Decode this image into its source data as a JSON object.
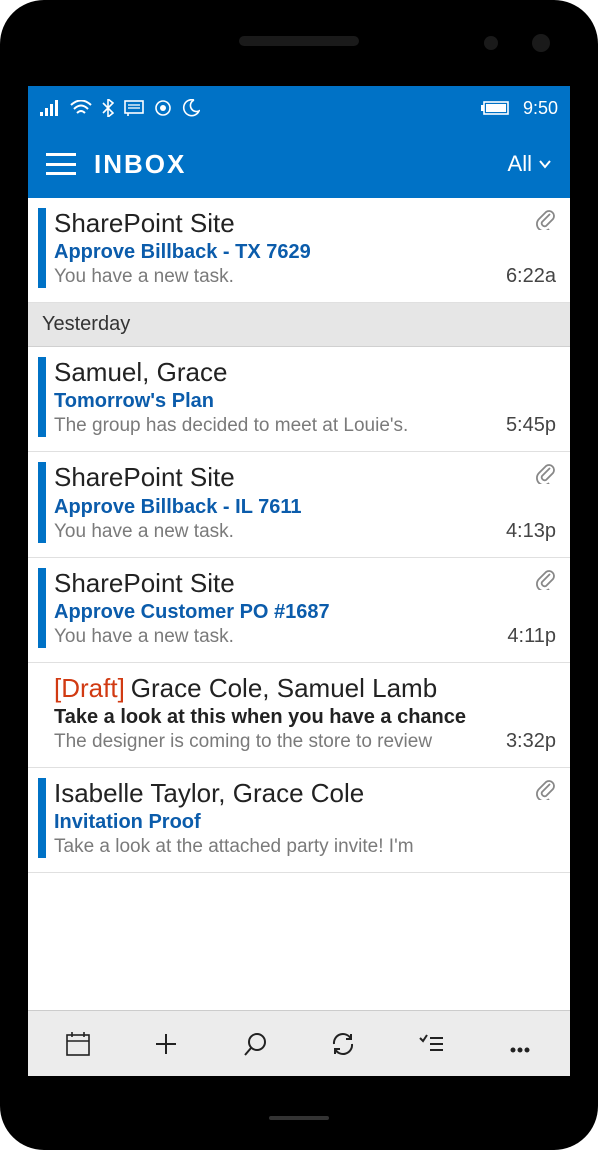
{
  "status": {
    "time": "9:50"
  },
  "appbar": {
    "title": "INBOX",
    "filter_label": "All"
  },
  "sections": [
    {
      "header": null,
      "items": [
        {
          "sender": "SharePoint Site",
          "draft": false,
          "subject": "Approve Billback - TX 7629",
          "subject_colored": true,
          "preview": "You have a new task.",
          "time": "6:22a",
          "attachment": true,
          "unread": true
        }
      ]
    },
    {
      "header": "Yesterday",
      "items": [
        {
          "sender": "Samuel, Grace",
          "draft": false,
          "subject": "Tomorrow's Plan",
          "subject_colored": true,
          "preview": "The group has decided to meet at Louie's.",
          "time": "5:45p",
          "attachment": false,
          "unread": true
        },
        {
          "sender": "SharePoint Site",
          "draft": false,
          "subject": "Approve Billback - IL 7611",
          "subject_colored": true,
          "preview": "You have a new task.",
          "time": "4:13p",
          "attachment": true,
          "unread": true
        },
        {
          "sender": "SharePoint Site",
          "draft": false,
          "subject": "Approve Customer PO #1687",
          "subject_colored": true,
          "preview": "You have a new task.",
          "time": "4:11p",
          "attachment": true,
          "unread": true
        },
        {
          "sender": "Grace Cole, Samuel Lamb",
          "draft": true,
          "draft_label": "[Draft]",
          "subject": "Take a look at this when you have a chance",
          "subject_colored": false,
          "preview": "The designer is coming to the store to review",
          "time": "3:32p",
          "attachment": false,
          "unread": false
        },
        {
          "sender": "Isabelle Taylor, Grace Cole",
          "draft": false,
          "subject": "Invitation Proof",
          "subject_colored": true,
          "preview": "Take a look at the attached party invite! I'm",
          "time": "",
          "attachment": true,
          "unread": true
        }
      ]
    }
  ]
}
